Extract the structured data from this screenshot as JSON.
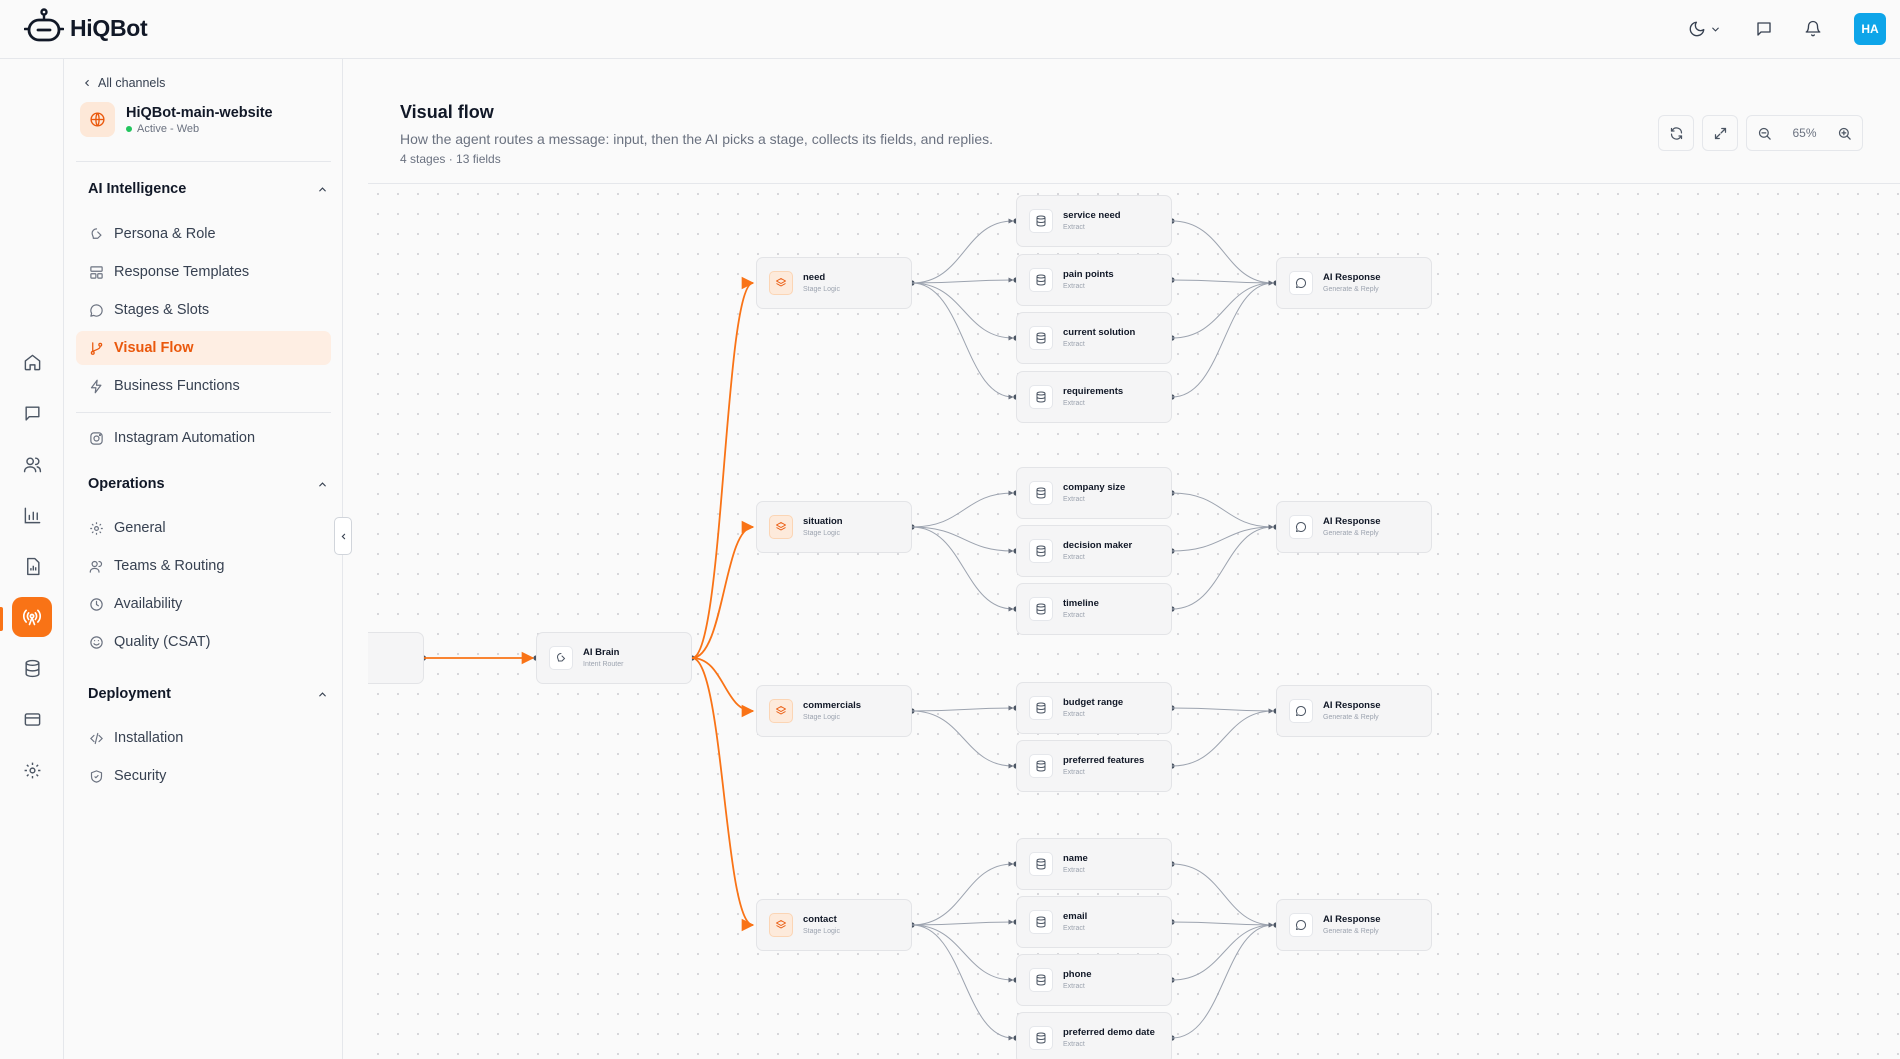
{
  "app": {
    "name": "HiQBot",
    "avatar_initials": "HA"
  },
  "topbar_icons": [
    "moon-icon",
    "chevron-down-icon",
    "chat-icon",
    "bell-icon"
  ],
  "rail": {
    "items": [
      "home-icon",
      "chat-icon",
      "users-icon",
      "bar-chart-icon",
      "report-icon",
      "broadcast-icon",
      "database-icon",
      "card-icon",
      "gear-icon"
    ],
    "active": "broadcast-icon",
    "accent": "#f97316"
  },
  "sidebar": {
    "back_label": "All channels",
    "channel": {
      "name": "HiQBot-main-website",
      "status": "Active - Web"
    },
    "sections": [
      {
        "title": "AI Intelligence",
        "items": [
          "Persona & Role",
          "Response Templates",
          "Stages & Slots",
          "Visual Flow",
          "Business Functions",
          "Instagram Automation"
        ]
      },
      {
        "title": "Operations",
        "items": [
          "General",
          "Teams & Routing",
          "Availability",
          "Quality (CSAT)"
        ]
      },
      {
        "title": "Deployment",
        "items": [
          "Installation",
          "Security"
        ]
      }
    ],
    "active_item": "Visual Flow"
  },
  "main": {
    "title": "Visual flow",
    "description": "How the agent routes a message: input, then the AI picks a stage, collects its fields, and replies.",
    "meta": "4 stages · 13 fields",
    "zoom": "65%"
  },
  "flow": {
    "router": {
      "title": "AI Brain",
      "subtitle": "Intent Router"
    },
    "stages": [
      {
        "title": "need",
        "subtitle": "Stage Logic",
        "fields": [
          "service need",
          "pain points",
          "current solution",
          "requirements"
        ]
      },
      {
        "title": "situation",
        "subtitle": "Stage Logic",
        "fields": [
          "company size",
          "decision maker",
          "timeline"
        ]
      },
      {
        "title": "commercials",
        "subtitle": "Stage Logic",
        "fields": [
          "budget range",
          "preferred features"
        ]
      },
      {
        "title": "contact",
        "subtitle": "Stage Logic",
        "fields": [
          "name",
          "email",
          "phone",
          "preferred demo date"
        ]
      }
    ],
    "field_subtitle": "Extract",
    "response": {
      "title": "AI Response",
      "subtitle": "Generate & Reply"
    },
    "edge_color": "#f97316"
  }
}
